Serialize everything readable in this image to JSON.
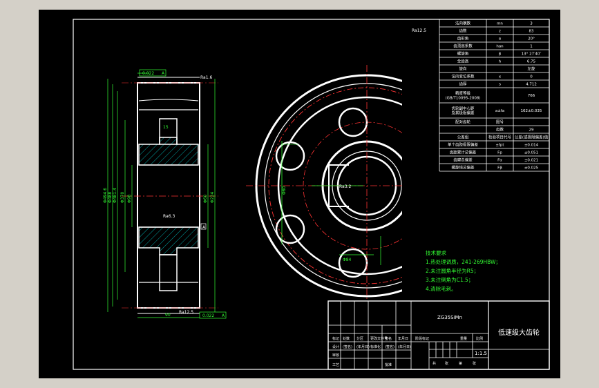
{
  "colors": {
    "background": "#000000",
    "frame": "#ffffff",
    "dimension": "#33ff33",
    "centerline": "#ff3333",
    "hatch": "#00cccc",
    "window": "#d4d0c8"
  },
  "params_table": [
    {
      "name": "法向模数",
      "symbol": "mn",
      "value": "3"
    },
    {
      "name": "齿数",
      "symbol": "z",
      "value": "83"
    },
    {
      "name": "齿形角",
      "symbol": "α",
      "value": "20°"
    },
    {
      "name": "齿顶高系数",
      "symbol": "han",
      "value": "1"
    },
    {
      "name": "螺旋角",
      "symbol": "β",
      "value": "13° 27′40″"
    },
    {
      "name": "全齿高",
      "symbol": "h",
      "value": "6.75"
    },
    {
      "name": "旋向",
      "symbol": "",
      "value": "左旋"
    },
    {
      "name": "法向变位系数",
      "symbol": "x",
      "value": "0"
    },
    {
      "name": "齿厚",
      "symbol": "s",
      "value": "4.712"
    },
    {
      "name": "精度等级\n(GB/T10095-2008)",
      "symbol": "",
      "value": "766"
    },
    {
      "name": "齿轮副中心距\n及其极限偏差",
      "symbol": "a±fa",
      "value": "162±0.035"
    },
    {
      "name": "配对齿轮",
      "symbol": "图号",
      "value": ""
    },
    {
      "name": "",
      "symbol": "齿数",
      "value": "29"
    },
    {
      "name": "公差组",
      "symbol": "检验项目代号",
      "value": "公差(或极限偏差)值"
    },
    {
      "name": "单个齿距极限偏差",
      "symbol": "±fpt",
      "value": "±0.014"
    },
    {
      "name": "齿距累计总偏差",
      "symbol": "Fp",
      "value": "±0.051"
    },
    {
      "name": "齿廓总偏差",
      "symbol": "Fα",
      "value": "±0.021"
    },
    {
      "name": "螺旋线总偏差",
      "symbol": "Fβ",
      "value": "±0.025"
    }
  ],
  "tech_req": {
    "title": "技术要求",
    "items": [
      "1.热处理调质，241-269HBW；",
      "2.未注圆角半径为R5；",
      "3.未注倒角为C1.5；",
      "4.清除毛刺。"
    ]
  },
  "title_block": {
    "material": "ZG35SiMn",
    "part_name": "低速级大齿轮",
    "scale": "1:1.5",
    "header_labels": [
      "标记",
      "处数",
      "分区",
      "更改文件号",
      "签名",
      "年月日"
    ],
    "row_design": [
      "设计",
      "(签名)",
      "(年月日)",
      "标准化",
      "(签名)",
      "(年月日)"
    ],
    "row_review": "审核",
    "row_process": [
      "工艺",
      "批准"
    ],
    "stage_labels": [
      "阶段标记",
      "重量",
      "比例"
    ],
    "sheet_labels": [
      "共",
      "张",
      "第",
      "张"
    ]
  },
  "annotations": {
    "roughness_values": [
      "Ra1.6",
      "Ra3.2",
      "Ra6.3",
      "Ra12.5"
    ],
    "tolerance_frames": [
      "0.022",
      "A",
      "0.022",
      "A"
    ],
    "datum": "A",
    "dims_section_left": [
      "Φ494.6",
      "Φ488",
      "Φ481.4",
      "Φ370",
      "Φ98"
    ],
    "dims_section_right": [
      "Φ224",
      "Φ60"
    ],
    "dims_bottom": [
      "90"
    ],
    "dims_top": [
      "15"
    ],
    "dims_front": [
      "Φ60",
      "Φ84",
      "18",
      "Φ300"
    ]
  }
}
